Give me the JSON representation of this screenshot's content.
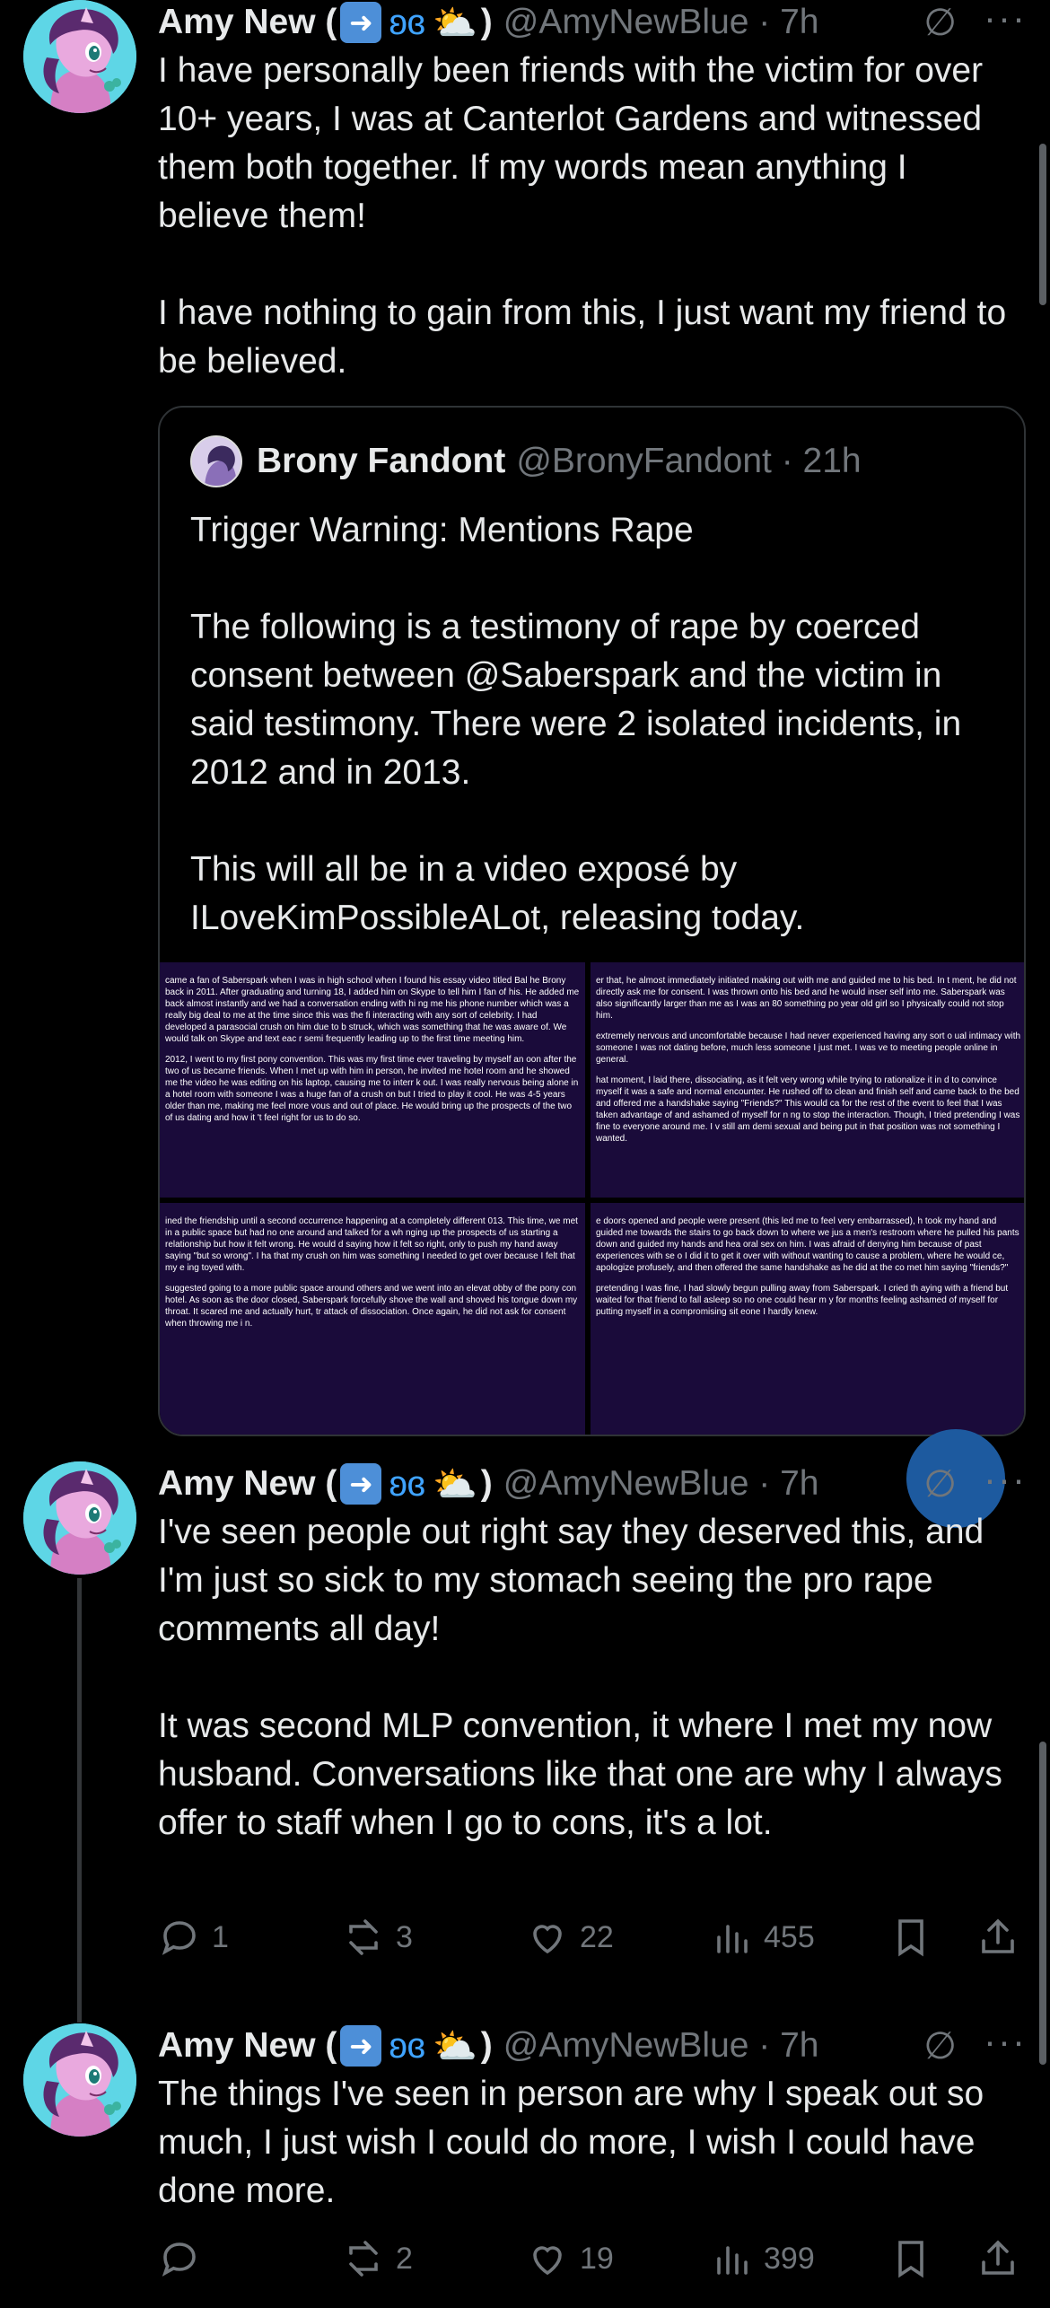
{
  "tweets": [
    {
      "author": "Amy New (",
      "author_close": ")",
      "handle": "@AmyNewBlue · 7h",
      "text": "I have personally been friends with the victim for over 10+ years, I was at Canterlot Gardens and witnessed them both together. If my words mean anything I believe them!\n\nI have nothing to gain from this, I just want my friend to be believed.",
      "quote": {
        "author": "Brony Fandont",
        "handle": "@BronyFandont · 21h",
        "text": "Trigger Warning: Mentions Rape\n\nThe following is a testimony of rape by coerced consent between @Saberspark and the victim in said testimony. There were 2 isolated incidents, in 2012 and in 2013.\n\nThis will all be in a video exposé by ILoveKimPossibleALot, releasing today.",
        "images": [
          {
            "p1": "came a fan of Saberspark when I was in high school when I found his essay video titled Bal he Brony back in 2011. After graduating and turning 18, I added him on Skype to tell him I fan of his. He added me back almost instantly and we had a conversation ending with hi ng me his phone number which was a really big deal to me at the time since this was the fi interacting with any sort of celebrity. I had developed a parasocial crush on him due to b struck, which was something that he was aware of. We would talk on Skype and text eac r semi frequently leading up to the first time meeting him.",
            "p2": "2012, I went to my first pony convention. This was my first time ever traveling by myself an oon after the two of us became friends. When I met up with him in person, he invited me hotel room and he showed me the video he was editing on his laptop, causing me to interr k out. I was really nervous being alone in a hotel room with someone I was a huge fan of a crush on but I tried to play it cool. He was 4-5 years older than me, making me feel more vous and out of place. He would bring up the prospects of the two of us dating and how it 't feel right for us to do so."
          },
          {
            "p1": "er that, he almost immediately initiated making out with me and guided me to his bed. In t ment, he did not directly ask me for consent. I was thrown onto his bed and he would inser self into me. Saberspark was also significantly larger than me as I was an 80 something po year old girl so I physically could not stop him.",
            "p2": "extremely nervous and uncomfortable because I had never experienced having any sort o ual intimacy with someone I was not dating before, much less someone I just met. I was ve to meeting people online in general.",
            "p3": "hat moment, I laid there, dissociating, as it felt very wrong while trying to rationalize it in d to convince myself it was a safe and normal encounter. He rushed off to clean and finish self and came back to the bed and offered me a handshake saying \"Friends?\" This would ca for the rest of the event to feel that I was taken advantage of and ashamed of myself for n ng to stop the interaction. Though, I tried pretending I was fine to everyone around me. I v still am demi sexual and being put in that position was not something I wanted."
          },
          {
            "p1": "ined the friendship until a second occurrence happening at a completely different 013. This time, we met in a public space but had no one around and talked for a wh nging up the prospects of us starting a relationship but how it felt wrong. He would d saying how it felt so right, only to push my hand away saying \"but so wrong\". I ha that my crush on him was something I needed to get over because I felt that my e ing toyed with.",
            "p2": "suggested going to a more public space around others and we went into an elevat obby of the pony con hotel. As soon as the door closed, Saberspark forcefully shove the wall and shoved his tongue down my throat. It scared me and actually hurt, tr attack of dissociation. Once again, he did not ask for consent when throwing me i n."
          },
          {
            "p1": "e doors opened and people were present (this led me to feel very embarrassed), h took my hand and guided me towards the stairs to go back down to where we jus a men's restroom where he pulled his pants down and guided my hands and hea oral sex on him. I was afraid of denying him because of past experiences with se o I did it to get it over with without wanting to cause a problem, where he would ce, apologize profusely, and then offered the same handshake as he did at the co met him saying \"friends?\"",
            "p2": "pretending I was fine, I had slowly begun pulling away from Saberspark. I cried th aying with a friend but waited for that friend to fall asleep so no one could hear m y for months feeling ashamed of myself for putting myself in a compromising sit eone I hardly knew."
          }
        ]
      }
    },
    {
      "author": "Amy New (",
      "author_close": ")",
      "handle": "@AmyNewBlue · 7h",
      "text": "I've seen people out right say they deserved this, and I'm just so sick to my stomach seeing the pro rape comments all day!\n\nIt was second MLP convention, it where I met my now husband. Conversations like that one are why I always offer to staff when I go to cons, it's a lot.",
      "replies": "1",
      "reposts": "3",
      "likes": "22",
      "views": "455"
    },
    {
      "author": "Amy New (",
      "author_close": ")",
      "handle": "@AmyNewBlue · 7h",
      "text": "The things I've seen in person are why I speak out so much, I just wish I could do more, I wish I could have done more.",
      "replies": "",
      "reposts": "2",
      "likes": "19",
      "views": "399"
    }
  ],
  "icons": [
    "right-arrow-emoji-icon",
    "butterfly-emoji-icon",
    "sun-cloud-emoji-icon",
    "grok-icon",
    "more-icon",
    "reply-icon",
    "repost-icon",
    "like-icon",
    "views-icon",
    "bookmark-icon",
    "share-icon"
  ],
  "colors": {
    "background": "#000000",
    "text": "#e7e9ea",
    "muted": "#71767b",
    "avatar_bg": "#5ed6e6",
    "testimony_bg": "#1a0b3a"
  }
}
